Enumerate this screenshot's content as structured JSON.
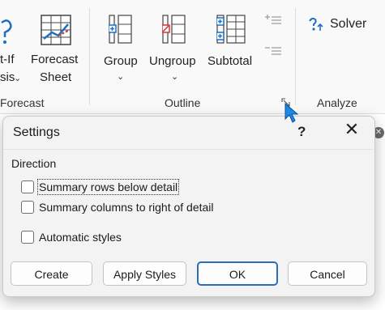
{
  "ribbon": {
    "whatif": {
      "line1": "t-If",
      "line2": "sis"
    },
    "forecast_sheet": {
      "line1": "Forecast",
      "line2": "Sheet"
    },
    "forecast_group_label": "Forecast",
    "group": {
      "label": "Group"
    },
    "ungroup": {
      "label": "Ungroup"
    },
    "subtotal": {
      "label": "Subtotal"
    },
    "outline_group_label": "Outline",
    "solver": {
      "label": "Solver"
    },
    "analyze_group_label": "Analyze"
  },
  "dialog": {
    "title": "Settings",
    "help": "?",
    "close": "✕",
    "section": "Direction",
    "options": [
      {
        "label": "Summary rows below detail",
        "checked": false
      },
      {
        "label": "Summary columns to right of detail",
        "checked": false
      },
      {
        "label": "Automatic styles",
        "checked": false
      }
    ],
    "buttons": {
      "create": "Create",
      "apply_styles": "Apply Styles",
      "ok": "OK",
      "cancel": "Cancel"
    }
  },
  "colors": {
    "accent": "#2a6fb7",
    "icon_blue": "#1f6fc5",
    "icon_red": "#d13438",
    "cursor": "#1e88e5"
  }
}
